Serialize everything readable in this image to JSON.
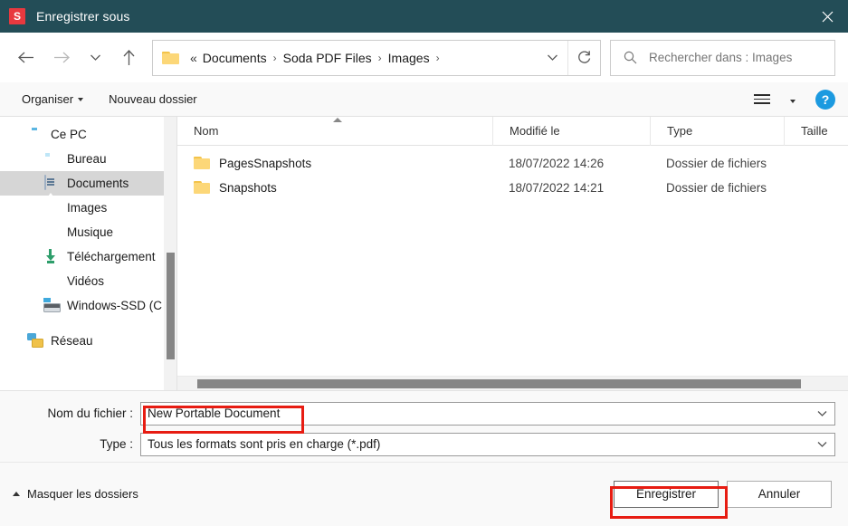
{
  "titlebar": {
    "app_icon_letter": "S",
    "title": "Enregistrer sous",
    "close_label": "close-icon"
  },
  "nav": {
    "back": "back-arrow",
    "forward": "forward-arrow",
    "recent": "recent-locations-chevron",
    "up": "up-arrow",
    "breadcrumb": {
      "overflow": "«",
      "items": [
        "Documents",
        "Soda PDF Files",
        "Images"
      ],
      "separator": "›",
      "trailing_separator": "›"
    },
    "dropdown": "chevron-down-icon",
    "refresh": "refresh-icon"
  },
  "search": {
    "placeholder": "Rechercher dans : Images",
    "icon": "search-icon"
  },
  "commandbar": {
    "organize": "Organiser",
    "new_folder": "Nouveau dossier",
    "view_icon": "view-options-icon",
    "help": "?"
  },
  "sidebar": {
    "items": [
      {
        "label": "Ce PC",
        "icon": "pc-icon",
        "level": "root",
        "selected": false
      },
      {
        "label": "Bureau",
        "icon": "desktop-icon",
        "level": "child",
        "selected": false
      },
      {
        "label": "Documents",
        "icon": "documents-icon",
        "level": "child",
        "selected": true
      },
      {
        "label": "Images",
        "icon": "pictures-icon",
        "level": "child",
        "selected": false
      },
      {
        "label": "Musique",
        "icon": "music-icon",
        "level": "child",
        "selected": false
      },
      {
        "label": "Téléchargement",
        "icon": "downloads-icon",
        "level": "child",
        "selected": false
      },
      {
        "label": "Vidéos",
        "icon": "videos-icon",
        "level": "child",
        "selected": false
      },
      {
        "label": "Windows-SSD (C",
        "icon": "drive-icon",
        "level": "child",
        "selected": false
      },
      {
        "label": "Réseau",
        "icon": "network-icon",
        "level": "root",
        "selected": false
      }
    ]
  },
  "filelist": {
    "columns": [
      "Nom",
      "Modifié le",
      "Type",
      "Taille"
    ],
    "sorted_by": "Nom",
    "sort_direction": "ascending",
    "rows": [
      {
        "name": "PagesSnapshots",
        "modified": "18/07/2022 14:26",
        "type": "Dossier de fichiers",
        "size": ""
      },
      {
        "name": "Snapshots",
        "modified": "18/07/2022 14:21",
        "type": "Dossier de fichiers",
        "size": ""
      }
    ]
  },
  "form": {
    "filename_label": "Nom du fichier :",
    "filename_value": "New Portable Document",
    "type_label": "Type :",
    "type_value": "Tous les formats sont pris en charge (*.pdf)"
  },
  "footer": {
    "hide_folders": "Masquer les dossiers",
    "save": "Enregistrer",
    "cancel": "Annuler"
  },
  "colors": {
    "titlebar_bg": "#234d57",
    "app_icon": "#e8393f",
    "help_blue": "#1c9ae0",
    "annotation_red": "#e71c12",
    "folder_yellow": "#fcd778",
    "selected_row": "#d6d6d6"
  }
}
